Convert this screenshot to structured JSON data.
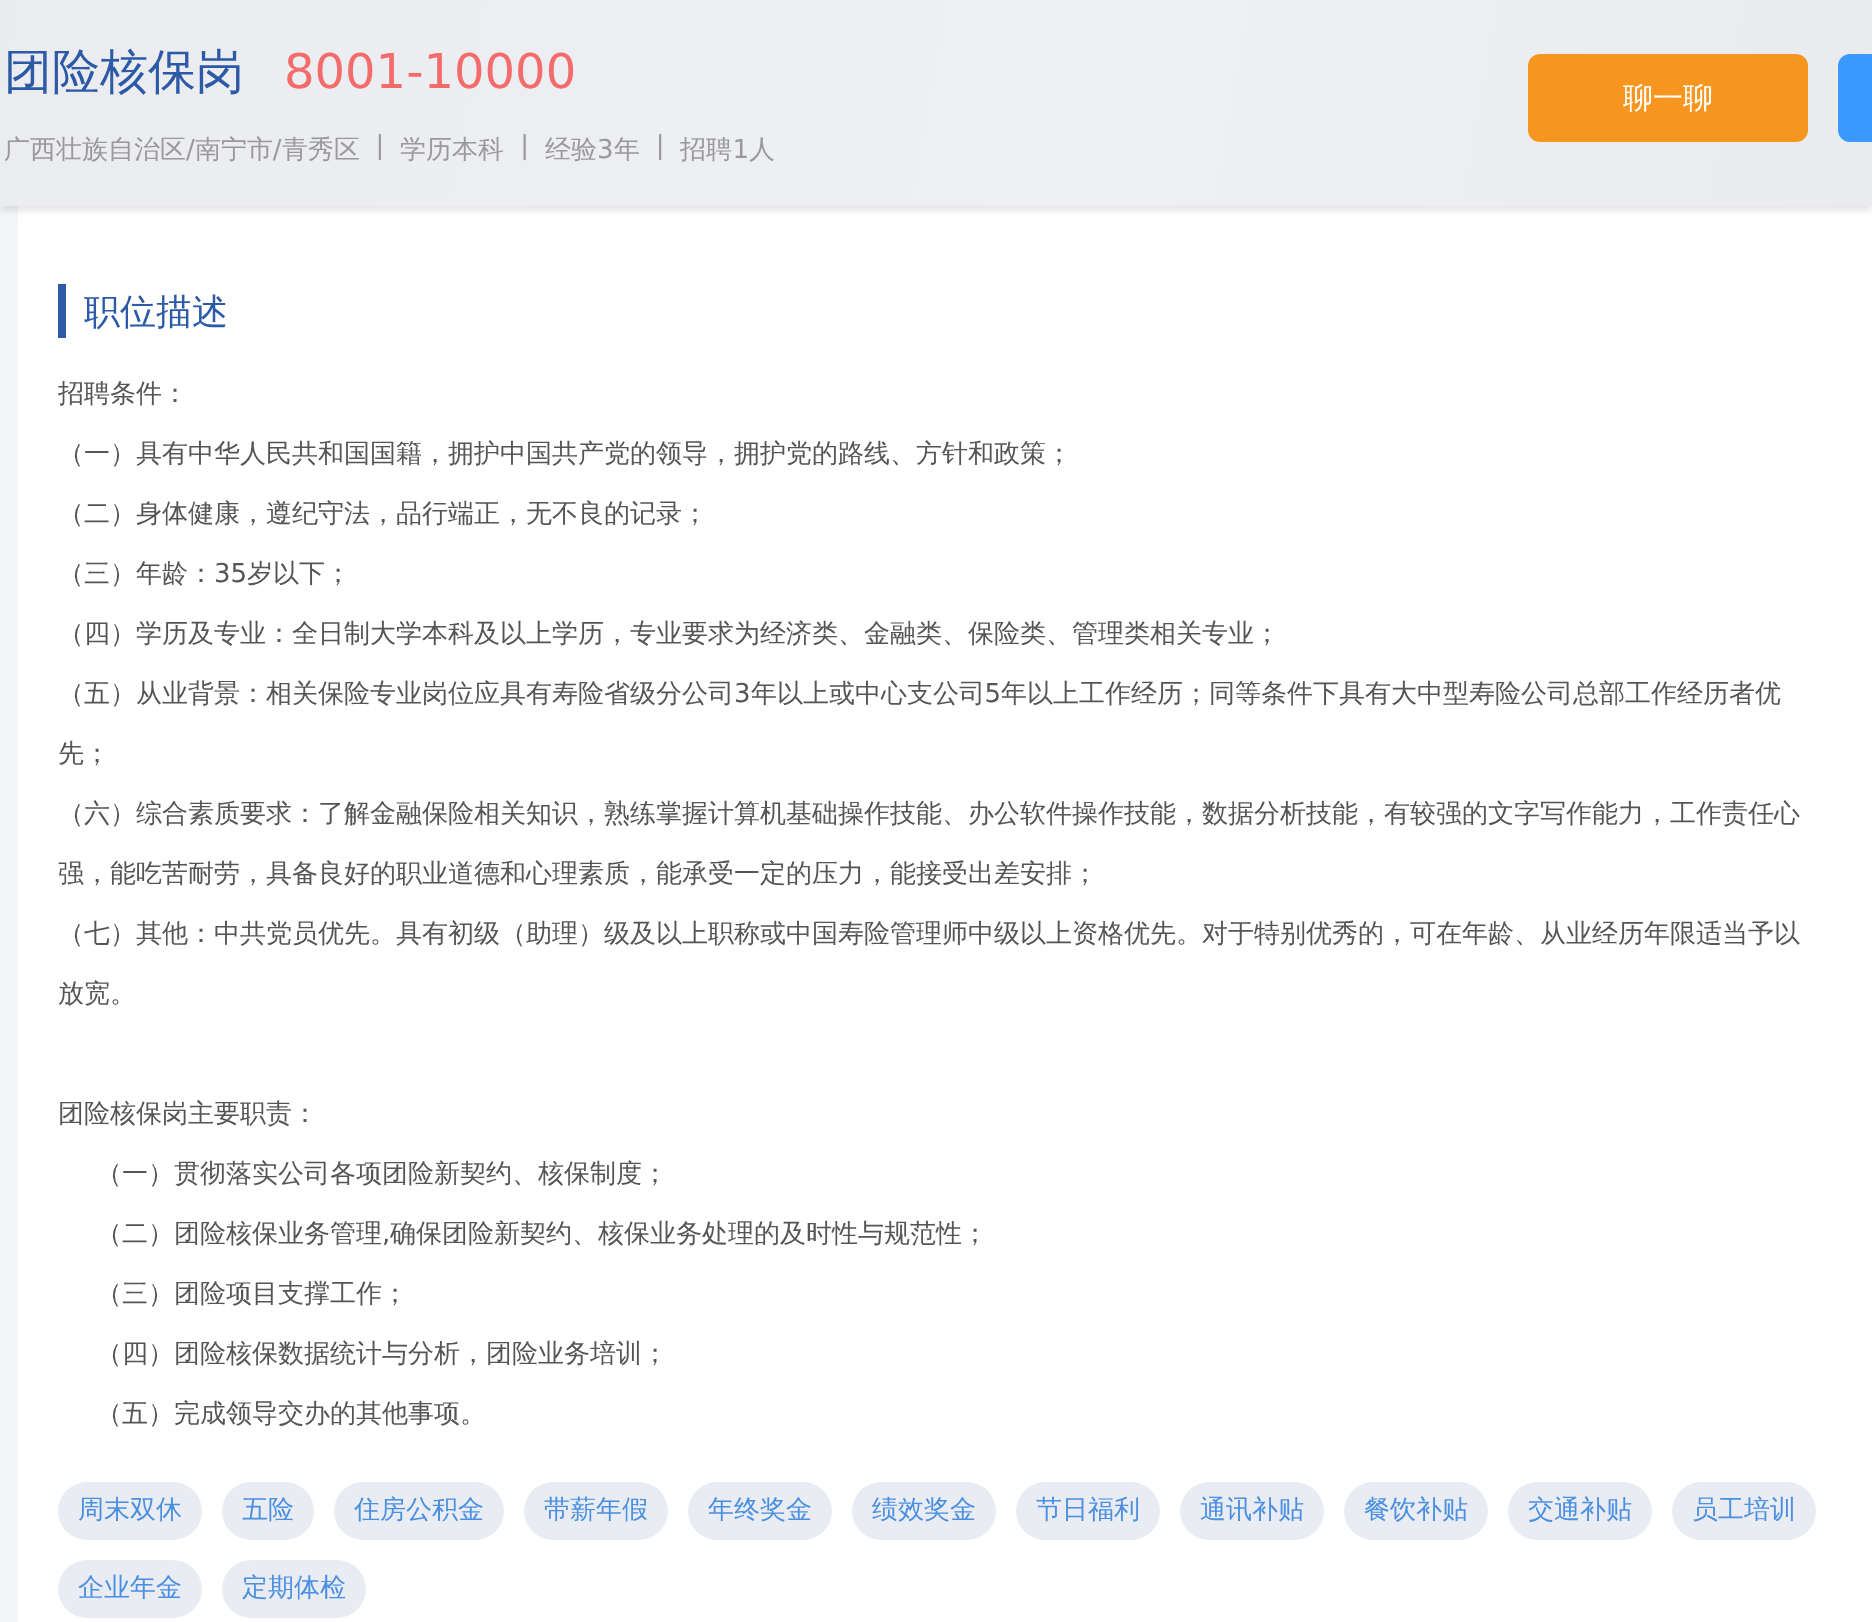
{
  "header": {
    "title": "团险核保岗",
    "salary": "8001-10000",
    "meta": [
      "广西壮族自治区/南宁市/青秀区",
      "学历本科",
      "经验3年",
      "招聘1人"
    ],
    "separator": "|",
    "buttons": [
      {
        "label": "聊一聊",
        "kind": "chat"
      },
      {
        "kind": "apply"
      }
    ]
  },
  "section": {
    "heading": "职位描述",
    "requirements": {
      "title": "招聘条件：",
      "items": [
        "（一）具有中华人民共和国国籍，拥护中国共产党的领导，拥护党的路线、方针和政策；",
        "（二）身体健康，遵纪守法，品行端正，无不良的记录；",
        "（三）年龄：35岁以下；",
        "（四）学历及专业：全日制大学本科及以上学历，专业要求为经济类、金融类、保险类、管理类相关专业；",
        "（五）从业背景：相关保险专业岗位应具有寿险省级分公司3年以上或中心支公司5年以上工作经历；同等条件下具有大中型寿险公司总部工作经历者优先；",
        "（六）综合素质要求：了解金融保险相关知识，熟练掌握计算机基础操作技能、办公软件操作技能，数据分析技能，有较强的文字写作能力，工作责任心强，能吃苦耐劳，具备良好的职业道德和心理素质，能承受一定的压力，能接受出差安排；",
        "（七）其他：中共党员优先。具有初级（助理）级及以上职称或中国寿险管理师中级以上资格优先。对于特别优秀的，可在年龄、从业经历年限适当予以放宽。"
      ]
    },
    "duties": {
      "title": "团险核保岗主要职责：",
      "items": [
        "（一）贯彻落实公司各项团险新契约、核保制度；",
        "（二）团险核保业务管理,确保团险新契约、核保业务处理的及时性与规范性；",
        "（三）团险项目支撑工作；",
        "（四）团险核保数据统计与分析，团险业务培训；",
        "（五）完成领导交办的其他事项。"
      ]
    },
    "benefits": [
      "周末双休",
      "五险",
      "住房公积金",
      "带薪年假",
      "年终奖金",
      "绩效奖金",
      "节日福利",
      "通讯补贴",
      "餐饮补贴",
      "交通补贴",
      "员工培训",
      "企业年金",
      "定期体检"
    ]
  }
}
